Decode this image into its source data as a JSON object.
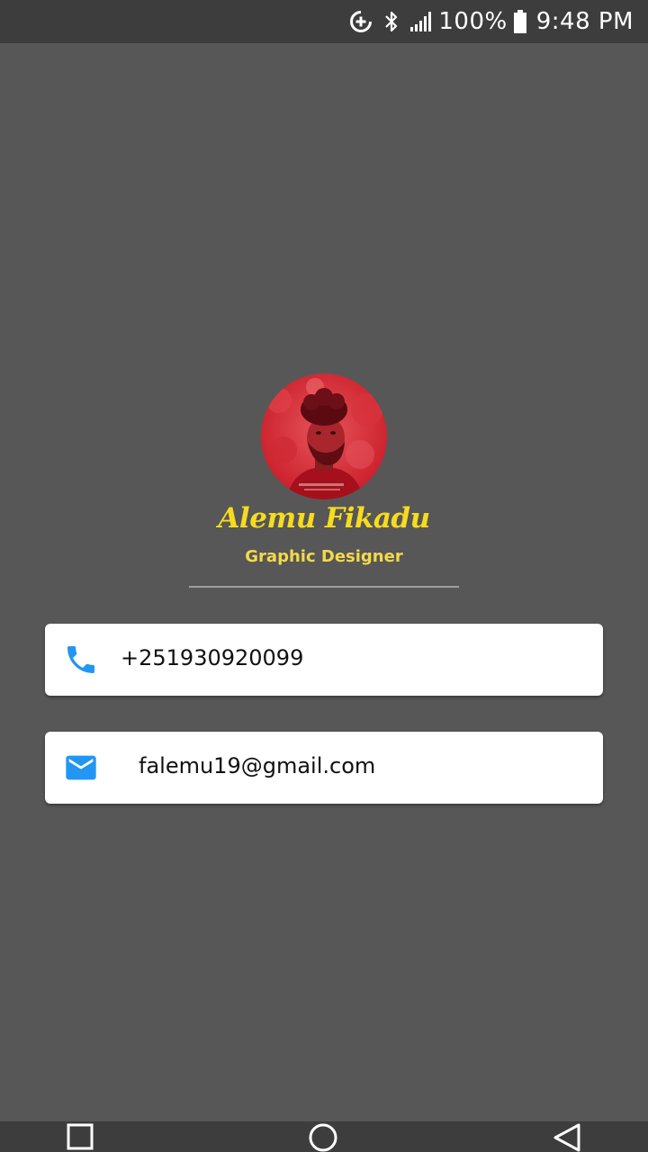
{
  "status_bar": {
    "battery_percent": "100%",
    "time": "9:48 PM",
    "icons": [
      "data-saver-icon",
      "bluetooth-icon",
      "signal-icon",
      "battery-icon"
    ]
  },
  "profile": {
    "name": "Alemu Fikadu",
    "role": "Graphic Designer",
    "avatar_icon": "profile-photo",
    "name_color": "#f7dc1e",
    "role_color": "#f4d94a"
  },
  "contacts": {
    "phone": {
      "icon": "phone-icon",
      "value": "+251930920099"
    },
    "email": {
      "icon": "mail-icon",
      "value": "falemu19@gmail.com"
    },
    "icon_color": "#2196f3"
  },
  "nav_bar": {
    "buttons": [
      "recents-icon",
      "home-icon",
      "back-icon"
    ]
  },
  "colors": {
    "background": "#575757",
    "system_bars": "#3d3d3d",
    "card": "#ffffff"
  }
}
